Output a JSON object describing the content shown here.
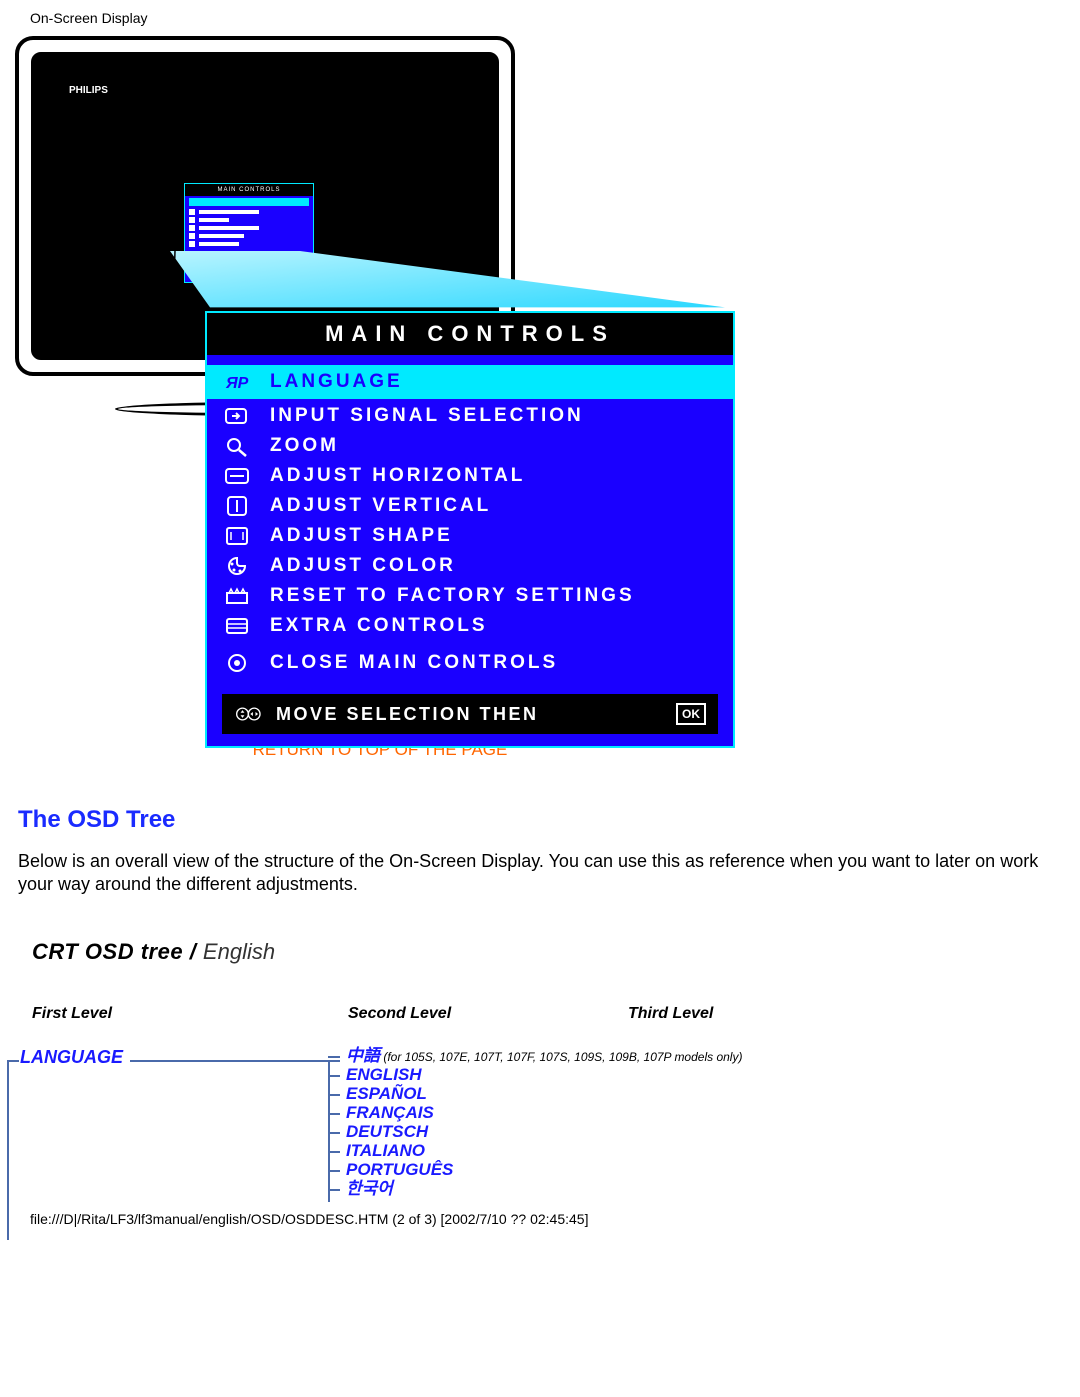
{
  "header": "On-Screen Display",
  "monitor_logo": "PHILIPS",
  "osd": {
    "title": "MAIN CONTROLS",
    "items": [
      {
        "label": "LANGUAGE",
        "selected": true,
        "icon": "language"
      },
      {
        "label": "INPUT SIGNAL SELECTION",
        "selected": false,
        "icon": "input"
      },
      {
        "label": "ZOOM",
        "selected": false,
        "icon": "zoom"
      },
      {
        "label": "ADJUST HORIZONTAL",
        "selected": false,
        "icon": "horiz"
      },
      {
        "label": "ADJUST VERTICAL",
        "selected": false,
        "icon": "vert"
      },
      {
        "label": "ADJUST SHAPE",
        "selected": false,
        "icon": "shape"
      },
      {
        "label": "ADJUST COLOR",
        "selected": false,
        "icon": "color"
      },
      {
        "label": "RESET TO FACTORY SETTINGS",
        "selected": false,
        "icon": "reset"
      },
      {
        "label": "EXTRA CONTROLS",
        "selected": false,
        "icon": "extra"
      }
    ],
    "close_label": "CLOSE MAIN CONTROLS",
    "move_label": "MOVE SELECTION THEN",
    "ok_label": "OK"
  },
  "return_link": "RETURN TO TOP OF THE PAGE",
  "section": {
    "heading": "The OSD Tree",
    "body": "Below is an overall view of the structure of the On-Screen Display. You can use this as reference when you want to later on work your way around the different adjustments."
  },
  "tree": {
    "heading_bold": "CRT OSD tree",
    "heading_sep": " / ",
    "heading_thin": "English",
    "levels": {
      "l1": "First Level",
      "l2": "Second Level",
      "l3": "Third Level"
    },
    "first_item": "LANGUAGE",
    "langs": [
      {
        "label": "中語",
        "note": "(for 105S, 107E, 107T, 107F, 107S, 109S, 109B, 107P models only)"
      },
      {
        "label": "ENGLISH"
      },
      {
        "label": "ESPAÑOL"
      },
      {
        "label": "FRANÇAIS"
      },
      {
        "label": "DEUTSCH"
      },
      {
        "label": "ITALIANO"
      },
      {
        "label": "PORTUGUÊS"
      },
      {
        "label": "한국어"
      }
    ]
  },
  "footer": "file:///D|/Rita/LF3/lf3manual/english/OSD/OSDDESC.HTM (2 of 3) [2002/7/10 ?? 02:45:45]"
}
